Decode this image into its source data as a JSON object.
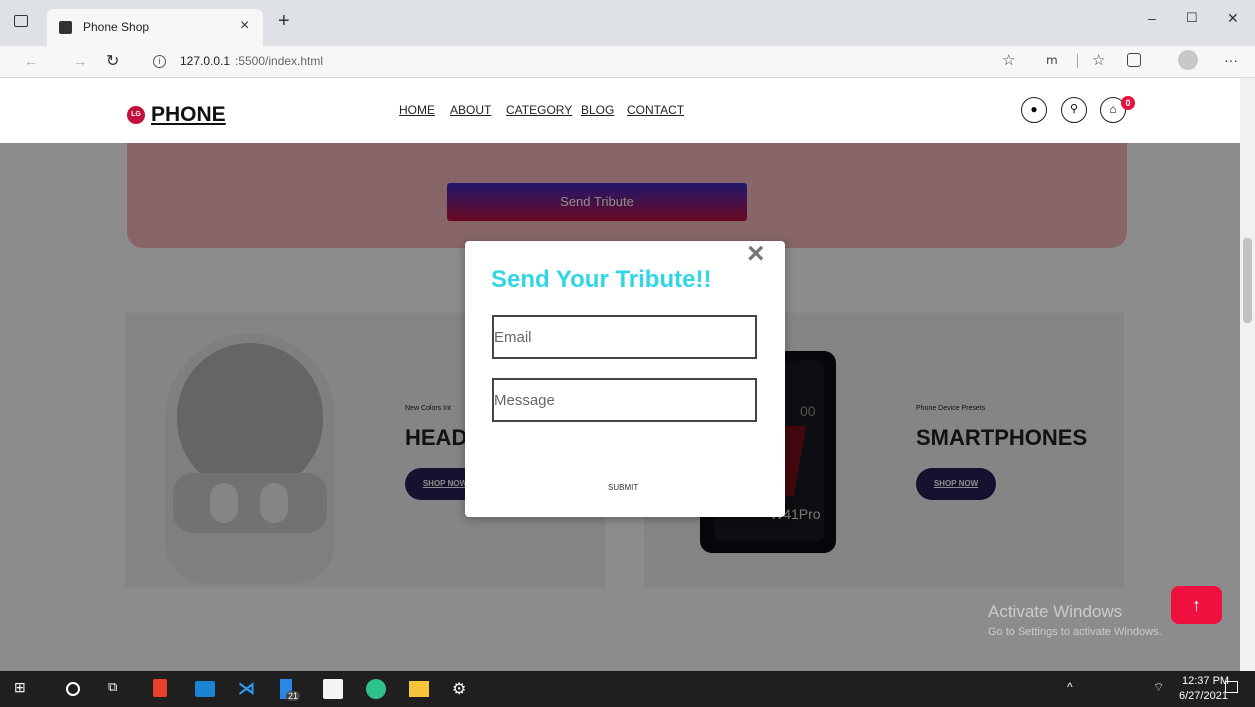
{
  "browser": {
    "tab_title": "Phone Shop",
    "tab_close": "×",
    "new_tab": "+",
    "url_host": "127.0.0.1",
    "url_rest": ":5500/index.html",
    "menu": "···",
    "win_min": "–",
    "win_max": "☐",
    "win_close": "✕"
  },
  "site": {
    "logo_mark": "LG",
    "logo_text": "PHONE",
    "nav": [
      "HOME",
      "ABOUT",
      "CATEGORY",
      "BLOG",
      "CONTACT"
    ],
    "cart_count": "0",
    "send_tribute": "Send Tribute"
  },
  "cards": [
    {
      "kicker": "New Colors Int",
      "title": "HEAD",
      "button": "SHOP NOW"
    },
    {
      "kicker": "Phone Device Presets",
      "title": "SMARTPHONES",
      "button": "SHOP NOW",
      "phone_brand": "W41Pro",
      "phone_time": "00"
    }
  ],
  "modal": {
    "title": "Send Your Tribute!!",
    "close": "×",
    "email_placeholder": "Email",
    "message_placeholder": "Message",
    "submit": "SUBMIT"
  },
  "watermark": {
    "line1": "Activate Windows",
    "line2": "Go to Settings to activate Windows."
  },
  "taskbar": {
    "time": "12:37 PM",
    "date": "6/27/2021",
    "badge": "21"
  },
  "colors": {
    "accent_cyan": "#2ed6e8",
    "brand_red": "#c4103c",
    "cta_navy": "#2b1f57"
  }
}
